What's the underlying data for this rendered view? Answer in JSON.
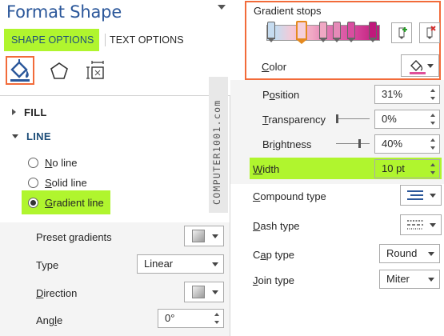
{
  "pane": {
    "title": "Format Shape"
  },
  "tabs": {
    "shape_options": "SHAPE OPTIONS",
    "text_options": "TEXT OPTIONS"
  },
  "watermark": "COMPUTER1001.com",
  "sections": {
    "fill": "FILL",
    "line": "LINE"
  },
  "line_options": {
    "no_line": {
      "underlined": "N",
      "rest": "o line"
    },
    "solid_line": {
      "underlined": "S",
      "rest": "olid line"
    },
    "gradient_line": {
      "underlined": "G",
      "rest": "radient line",
      "selected": true
    }
  },
  "left_props": {
    "preset_gradients": {
      "label_u": "",
      "label_rest": "Preset gradients"
    },
    "type": {
      "label_u": "",
      "label_rest": "Type",
      "value": "Linear"
    },
    "direction": {
      "label_u": "D",
      "label_rest": "irection"
    },
    "angle": {
      "label_pre": "Ang",
      "label_u": "l",
      "label_post": "e",
      "value": "0°"
    }
  },
  "gradient_stops": {
    "title": "Gradient stops",
    "stop_colors": [
      "#c6dcf0",
      "#f5d0dc",
      "#f0a8c4",
      "#e58ab8",
      "#d94da0",
      "#c0197b"
    ]
  },
  "right_props": {
    "color": {
      "label_pre": "",
      "label_u": "C",
      "label_post": "olor",
      "swatch_color": "#e0509a"
    },
    "position": {
      "label_pre": "P",
      "label_u": "o",
      "label_post": "sition",
      "value": "31%"
    },
    "transparency": {
      "label_pre": "",
      "label_u": "T",
      "label_post": "ransparency",
      "value": "0%"
    },
    "brightness": {
      "label_pre": "Br",
      "label_u": "i",
      "label_post": "ghtness",
      "value": "40%"
    },
    "width": {
      "label_pre": "",
      "label_u": "W",
      "label_post": "idth",
      "value": "10 pt"
    },
    "compound_type": {
      "label_pre": "",
      "label_u": "C",
      "label_post": "ompound type"
    },
    "dash_type": {
      "label_pre": "",
      "label_u": "D",
      "label_post": "ash type"
    },
    "cap_type": {
      "label_pre": "C",
      "label_u": "a",
      "label_post": "p type",
      "value": "Round"
    },
    "join_type": {
      "label_pre": "",
      "label_u": "J",
      "label_post": "oin type",
      "value": "Miter"
    }
  },
  "colors": {
    "accent_green": "#b0f52e",
    "highlight_orange": "#f26b3a",
    "title_blue": "#2b579a"
  }
}
